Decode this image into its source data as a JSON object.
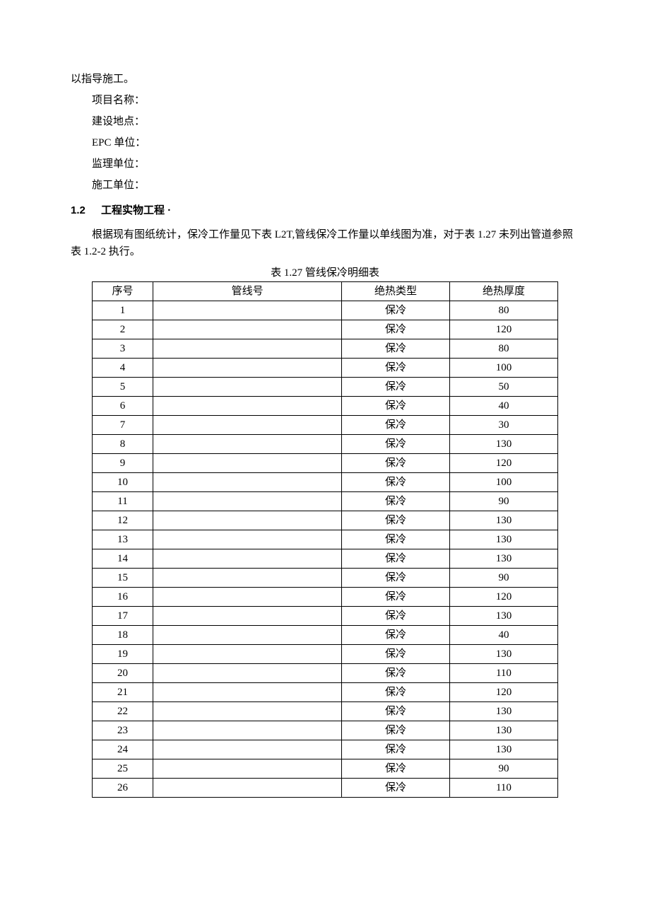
{
  "intro_line": "以指导施工。",
  "fields": {
    "project_name": "项目名称：",
    "site": "建设地点：",
    "epc": "EPC 单位：",
    "supervisor": "监理单位：",
    "contractor": "施工单位："
  },
  "section": {
    "num": "1.2",
    "title": "工程实物工程 ·"
  },
  "para": "根据现有图纸统计，保冷工作量见下表 L2T,管线保冷工作量以单线图为准，对于表 1.27 未列出管道参照表 1.2-2 执行。",
  "table": {
    "caption": "表 1.27 管线保冷明细表",
    "headers": {
      "c0": "序号",
      "c1": "管线号",
      "c2": "绝热类型",
      "c3": "绝热厚度"
    },
    "rows": [
      {
        "idx": "1",
        "pipe": "",
        "type": "保冷",
        "thick": "80"
      },
      {
        "idx": "2",
        "pipe": "",
        "type": "保冷",
        "thick": "120"
      },
      {
        "idx": "3",
        "pipe": "",
        "type": "保冷",
        "thick": "80"
      },
      {
        "idx": "4",
        "pipe": "",
        "type": "保冷",
        "thick": "100"
      },
      {
        "idx": "5",
        "pipe": "",
        "type": "保冷",
        "thick": "50"
      },
      {
        "idx": "6",
        "pipe": "",
        "type": "保冷",
        "thick": "40"
      },
      {
        "idx": "7",
        "pipe": "",
        "type": "保冷",
        "thick": "30"
      },
      {
        "idx": "8",
        "pipe": "",
        "type": "保冷",
        "thick": "130"
      },
      {
        "idx": "9",
        "pipe": "",
        "type": "保冷",
        "thick": "120"
      },
      {
        "idx": "10",
        "pipe": "",
        "type": "保冷",
        "thick": "100"
      },
      {
        "idx": "11",
        "pipe": "",
        "type": "保冷",
        "thick": "90"
      },
      {
        "idx": "12",
        "pipe": "",
        "type": "保冷",
        "thick": "130"
      },
      {
        "idx": "13",
        "pipe": "",
        "type": "保冷",
        "thick": "130"
      },
      {
        "idx": "14",
        "pipe": "",
        "type": "保冷",
        "thick": "130"
      },
      {
        "idx": "15",
        "pipe": "",
        "type": "保冷",
        "thick": "90"
      },
      {
        "idx": "16",
        "pipe": "",
        "type": "保冷",
        "thick": "120"
      },
      {
        "idx": "17",
        "pipe": "",
        "type": "保冷",
        "thick": "130"
      },
      {
        "idx": "18",
        "pipe": "",
        "type": "保冷",
        "thick": "40"
      },
      {
        "idx": "19",
        "pipe": "",
        "type": "保冷",
        "thick": "130"
      },
      {
        "idx": "20",
        "pipe": "",
        "type": "保冷",
        "thick": "110"
      },
      {
        "idx": "21",
        "pipe": "",
        "type": "保冷",
        "thick": "120"
      },
      {
        "idx": "22",
        "pipe": "",
        "type": "保冷",
        "thick": "130"
      },
      {
        "idx": "23",
        "pipe": "",
        "type": "保冷",
        "thick": "130"
      },
      {
        "idx": "24",
        "pipe": "",
        "type": "保冷",
        "thick": "130"
      },
      {
        "idx": "25",
        "pipe": "",
        "type": "保冷",
        "thick": "90"
      },
      {
        "idx": "26",
        "pipe": "",
        "type": "保冷",
        "thick": "110"
      }
    ]
  }
}
